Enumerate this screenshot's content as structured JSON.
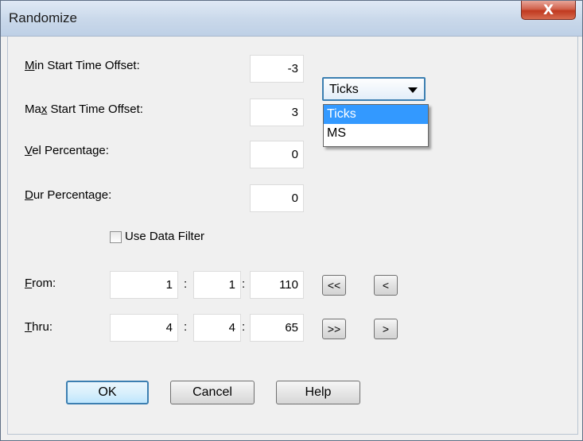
{
  "window": {
    "title": "Randomize",
    "close_glyph": "X"
  },
  "fields": {
    "min_start": {
      "label_u": "M",
      "label_rest": "in Start Time Offset:",
      "value": "-3"
    },
    "max_start": {
      "label_pre": "Ma",
      "label_u": "x",
      "label_rest": " Start Time Offset:",
      "value": "3"
    },
    "vel": {
      "label_u": "V",
      "label_rest": "el Percentage:",
      "value": "0"
    },
    "dur": {
      "label_u": "D",
      "label_rest": "ur Percentage:",
      "value": "0"
    }
  },
  "units_combo": {
    "selected": "Ticks",
    "options": [
      "Ticks",
      "MS"
    ],
    "highlighted_index": 0
  },
  "data_filter": {
    "label": "Use Data Filter",
    "checked": false
  },
  "from": {
    "label_u": "F",
    "label_rest": "rom:",
    "measure": "1",
    "beat": "1",
    "tick": "110",
    "btn_first": "<<",
    "btn_prev": "<"
  },
  "thru": {
    "label_u": "T",
    "label_rest": "hru:",
    "measure": "4",
    "beat": "4",
    "tick": "65",
    "btn_last": ">>",
    "btn_next": ">"
  },
  "separator": ":",
  "buttons": {
    "ok": "OK",
    "cancel": "Cancel",
    "help": "Help"
  }
}
